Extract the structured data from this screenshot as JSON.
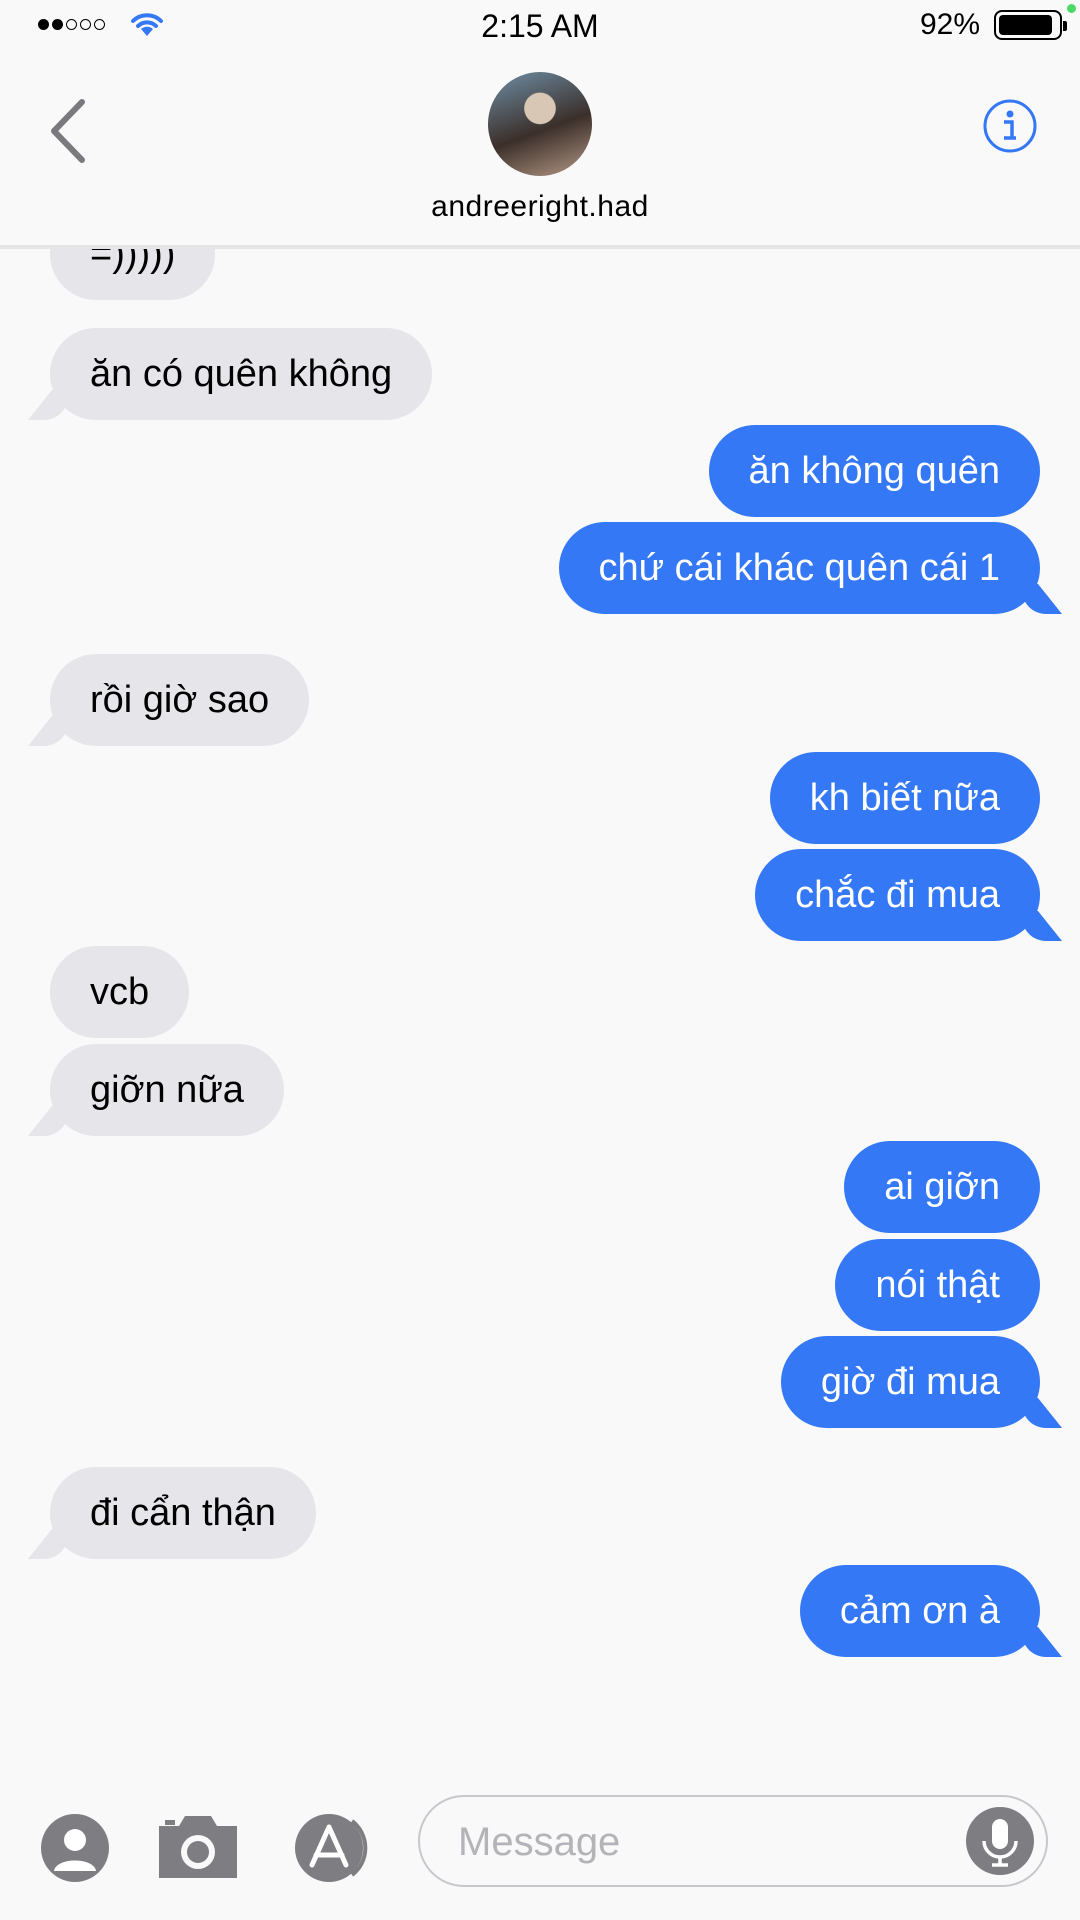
{
  "status_bar": {
    "time": "2:15 AM",
    "battery": "92%"
  },
  "header": {
    "contact_name": "andreeright.had"
  },
  "thread": {
    "messages": [
      {
        "text": "=)))))",
        "from": "them"
      },
      {
        "text": "ăn có quên không",
        "from": "them"
      },
      {
        "text": "ăn không quên",
        "from": "me"
      },
      {
        "text": "chứ cái khác quên cái 1",
        "from": "me"
      },
      {
        "text": "rồi giờ sao",
        "from": "them"
      },
      {
        "text": "kh biết nữa",
        "from": "me"
      },
      {
        "text": "chắc đi mua",
        "from": "me"
      },
      {
        "text": "vcb",
        "from": "them"
      },
      {
        "text": "giỡn nữa",
        "from": "them"
      },
      {
        "text": "ai giỡn",
        "from": "me"
      },
      {
        "text": "nói thật",
        "from": "me"
      },
      {
        "text": "giờ đi mua",
        "from": "me"
      },
      {
        "text": "đi cẩn thận",
        "from": "them"
      },
      {
        "text": "cảm ơn à",
        "from": "me"
      }
    ]
  },
  "composer": {
    "placeholder": "Message"
  },
  "colors": {
    "outgoing": "#3478f6",
    "incoming": "#e5e5ea",
    "accent": "#3478f6"
  },
  "icons": [
    "back-chevron-icon",
    "info-icon",
    "contacts-icon",
    "camera-icon",
    "app-store-icon",
    "microphone-icon"
  ]
}
